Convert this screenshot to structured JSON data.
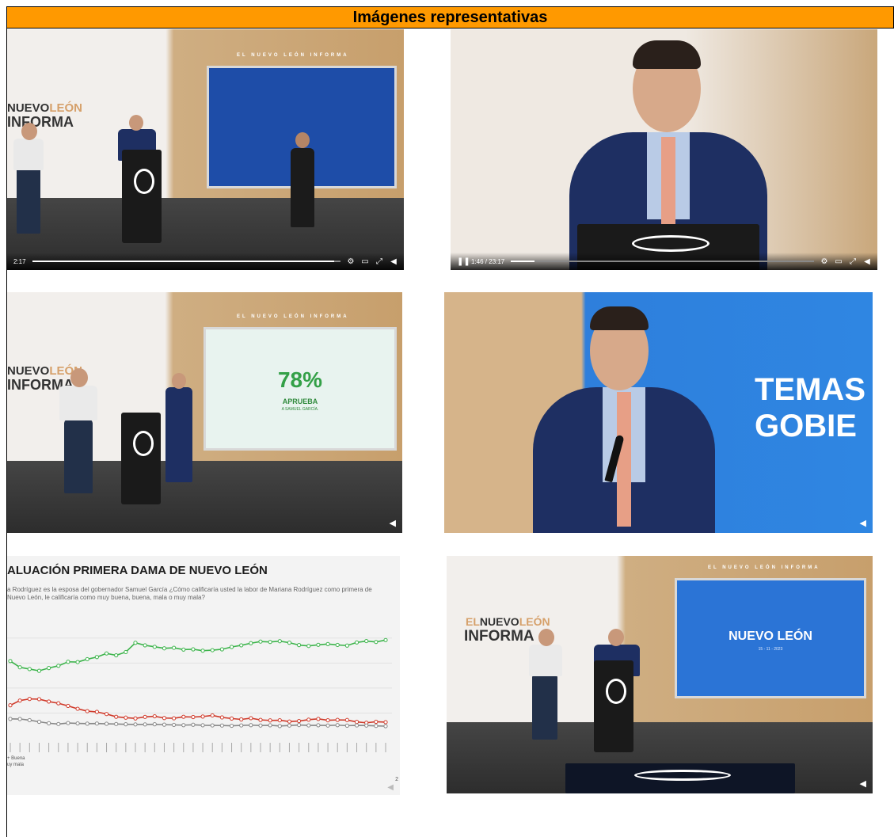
{
  "header": {
    "title": "Imágenes representativas"
  },
  "brand": {
    "line1_a": "EL",
    "line1_b": "NUEVO",
    "line1_c": "LEÓN",
    "line2": "INFORMA",
    "tagline": "EL NUEVO LEÓN INFORMA"
  },
  "shot1": {
    "time": "2:17"
  },
  "shot2": {
    "time": "1:46 / 23:17",
    "progress": 0.077
  },
  "shot3": {
    "percent": "78%",
    "caption1": "APRUEBA",
    "caption2": "A SAMUEL GARCÍA."
  },
  "shot4": {
    "line1": "TEMAS",
    "line2": "GOBIE"
  },
  "shot6": {
    "title": "NUEVO LEÓN",
    "date": "15 - 11 - 2023"
  },
  "chart_block": {
    "title": "ALUACIÓN PRIMERA DAMA DE NUEVO LEÓN",
    "question": "a Rodríguez es la esposa del gobernador Samuel García ¿Cómo calificaría usted la labor de Mariana Rodríguez como primera de Nuevo León, le calificaría como muy buena, buena, mala o muy mala?",
    "legend_a": "+ Buena",
    "legend_b": "uy mala",
    "page": "2"
  },
  "chart_data": {
    "type": "line",
    "title": "ALUACIÓN PRIMERA DAMA DE NUEVO LEÓN",
    "series": [
      {
        "name": "Buena",
        "color": "#3cb44b",
        "values": [
          61.6,
          56.6,
          55.2,
          53.8,
          56.0,
          57.8,
          61.0,
          60.8,
          63.1,
          64.8,
          67.7,
          66.2,
          68.8,
          76.2,
          74.2,
          73.0,
          71.8,
          72.2,
          70.8,
          71.0,
          69.9,
          70.3,
          71.0,
          72.9,
          74.2,
          75.9,
          77.2,
          76.9,
          77.5,
          76.3,
          74.4,
          73.7,
          74.6,
          75.2,
          74.5,
          74.0,
          76.5,
          77.6,
          76.9,
          78.4
        ]
      },
      {
        "name": "Mala",
        "color": "#d03a2a",
        "values": [
          26.2,
          30.0,
          31.3,
          31.1,
          29.2,
          27.8,
          25.7,
          23.4,
          21.5,
          20.9,
          19.2,
          17.0,
          16.3,
          15.7,
          16.9,
          17.4,
          16.0,
          15.8,
          17.0,
          16.8,
          17.2,
          18.1,
          16.5,
          15.6,
          14.9,
          15.9,
          14.5,
          14.1,
          14.2,
          13.2,
          13.6,
          14.7,
          15.3,
          14.2,
          14.5,
          14.4,
          12.9,
          12.2,
          13.0,
          12.7
        ]
      },
      {
        "name": "Muy mala",
        "color": "#888888",
        "values": [
          15.3,
          15.2,
          14.3,
          13.0,
          11.8,
          11.2,
          12.0,
          11.7,
          11.5,
          11.6,
          11.4,
          11.2,
          11.0,
          10.9,
          10.9,
          11.0,
          10.7,
          10.5,
          10.3,
          10.6,
          10.2,
          10.1,
          10.0,
          9.8,
          10.1,
          10.3,
          10.0,
          10.2,
          9.6,
          10.0,
          10.4,
          10.1,
          10.2,
          10.0,
          10.3,
          9.9,
          10.1,
          10.0,
          9.7,
          9.5
        ]
      }
    ]
  }
}
